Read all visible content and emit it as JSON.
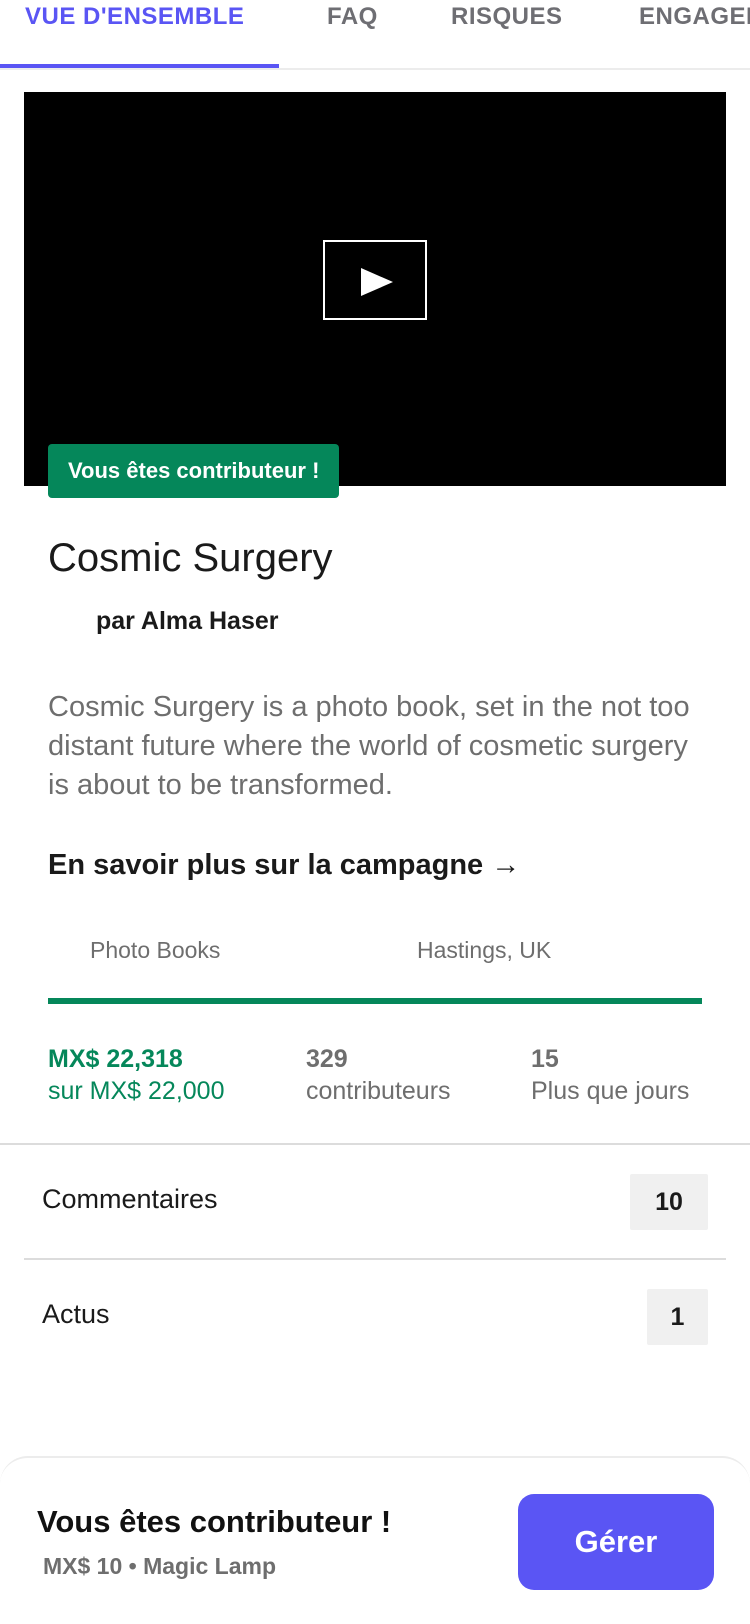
{
  "tabs": [
    {
      "label": "VUE D'ENSEMBLE",
      "active": true
    },
    {
      "label": "FAQ",
      "active": false
    },
    {
      "label": "RISQUES",
      "active": false
    },
    {
      "label": "ENGAGEMENT",
      "active": false
    }
  ],
  "video": {
    "play_icon": "play-icon"
  },
  "project": {
    "backer_badge": "Vous êtes contributeur !",
    "title": "Cosmic Surgery",
    "creator": "par Alma Haser",
    "blurb": "Cosmic Surgery is a photo book, set in the not too distant future where the world of cosmetic surgery is about to be transformed.",
    "learn_more": "En savoir plus sur la campagne →",
    "category": "Photo Books",
    "location": "Hastings, UK",
    "progress_fraction": 1.0
  },
  "stats": {
    "pledged_value": "MX$ 22,318",
    "pledged_goal": "sur MX$ 22,000",
    "backers_value": "329",
    "backers_label": "contributeurs",
    "days_value": "15",
    "days_label": "Plus que jours"
  },
  "rows": {
    "comments_label": "Commentaires",
    "comments_count": "10",
    "updates_label": "Actus",
    "updates_count": "1"
  },
  "bottom_bar": {
    "title": "Vous êtes contributeur !",
    "reward": "MX$ 10 • Magic Lamp",
    "manage_label": "Gérer"
  },
  "colors": {
    "accent": "#5a55f4",
    "success": "#05875a"
  }
}
